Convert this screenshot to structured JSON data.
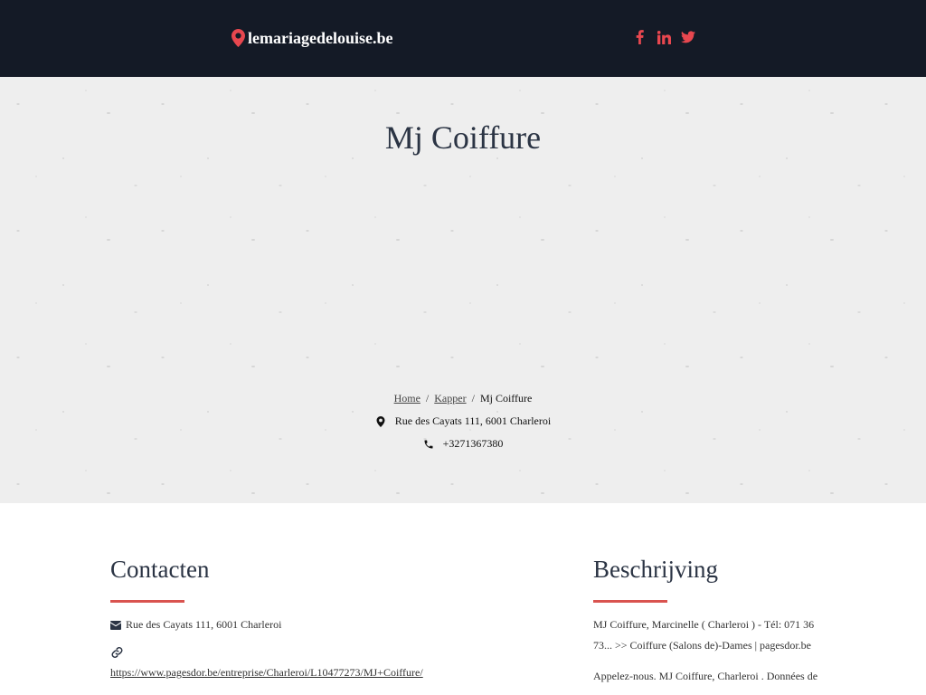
{
  "header": {
    "site_name": "lemariagedelouise.be",
    "socials": [
      "facebook-icon",
      "linkedin-icon",
      "twitter-icon"
    ],
    "accent_color": "#e8474f",
    "background_color": "#141a26"
  },
  "hero": {
    "title": "Mj Coiffure",
    "breadcrumb": {
      "home": "Home",
      "separator": "/",
      "category": "Kapper",
      "current": "Mj Coiffure"
    },
    "address": "Rue des Cayats 111, 6001 Charleroi",
    "phone": "+3271367380"
  },
  "contact": {
    "title": "Contacten",
    "address": "Rue des Cayats 111, 6001 Charleroi",
    "website": "https://www.pagesdor.be/entreprise/Charleroi/L10477273/MJ+Coiffure/"
  },
  "description": {
    "title": "Beschrijving",
    "paragraphs": [
      "MJ Coiffure, Marcinelle ( Charleroi ) - Tél: 071 36 73... >> Coiffure (Salons de)-Dames | pagesdor.be",
      "Appelez-nous. MJ Coiffure, Charleroi . Données de"
    ]
  }
}
